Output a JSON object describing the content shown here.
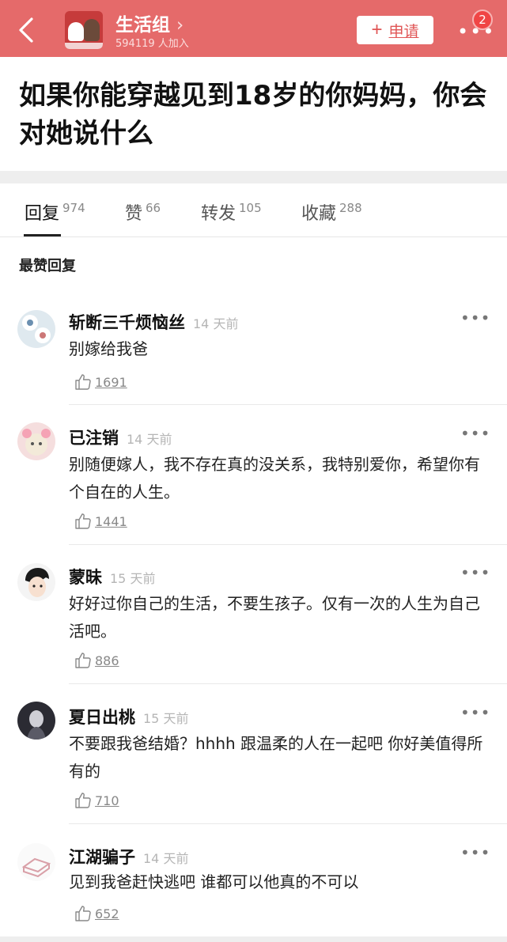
{
  "header": {
    "group_name": "生活组",
    "chevron": "›",
    "members": "594119 人加入",
    "apply_label": "申请",
    "apply_icon": "+",
    "more_icon": "•••",
    "badge_count": "2",
    "colors": {
      "bar": "#e56a6a",
      "accent": "#e05555",
      "badge": "#f04545"
    }
  },
  "post": {
    "title": "如果你能穿越见到18岁的你妈妈，你会对她说什么"
  },
  "tabs": [
    {
      "label": "回复",
      "count": "974",
      "active": true
    },
    {
      "label": "赞",
      "count": "66",
      "active": false
    },
    {
      "label": "转发",
      "count": "105",
      "active": false
    },
    {
      "label": "收藏",
      "count": "288",
      "active": false
    }
  ],
  "section_label": "最赞回复",
  "comments": [
    {
      "name": "斩断三千烦恼丝",
      "time": "14 天前",
      "text": "别嫁给我爸",
      "likes": "1691"
    },
    {
      "name": "已注销",
      "time": "14 天前",
      "text": "别随便嫁人，我不存在真的没关系，我特别爱你，希望你有个自在的人生。",
      "likes": "1441"
    },
    {
      "name": "蒙昧",
      "time": "15 天前",
      "text": "好好过你自己的生活，不要生孩子。仅有一次的人生为自己活吧。",
      "likes": "886"
    },
    {
      "name": "夏日出桃",
      "time": "15 天前",
      "text": "不要跟我爸结婚？hhhh 跟温柔的人在一起吧 你好美值得所有的",
      "likes": "710"
    },
    {
      "name": "江湖骗子",
      "time": "14 天前",
      "text": "见到我爸赶快逃吧 谁都可以他真的不可以",
      "likes": "652"
    }
  ]
}
